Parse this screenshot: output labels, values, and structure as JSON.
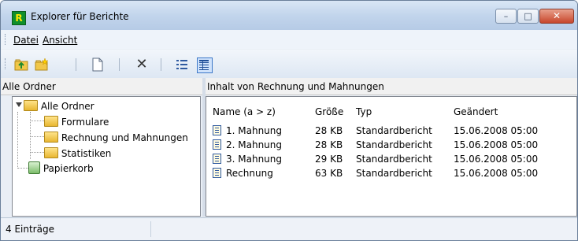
{
  "window": {
    "title": "Explorer für Berichte",
    "app_icon_letter": "R"
  },
  "title_buttons": {
    "minimize": "–",
    "maximize": "□",
    "close": "✕"
  },
  "menu": {
    "items": [
      {
        "label": "Datei"
      },
      {
        "label": "Ansicht"
      }
    ]
  },
  "toolbar": {
    "icons": [
      "folder-up-icon",
      "new-folder-icon",
      "new-report-icon",
      "delete-icon",
      "details-view-icon",
      "list-view-icon"
    ],
    "delete_glyph": "✕"
  },
  "left_pane": {
    "header": "Alle Ordner",
    "tree": {
      "root": "Alle Ordner",
      "children": [
        {
          "label": "Formulare"
        },
        {
          "label": "Rechnung und Mahnungen"
        },
        {
          "label": "Statistiken"
        }
      ],
      "recycle_bin": "Papierkorb"
    }
  },
  "right_pane": {
    "header": "Inhalt von Rechnung und Mahnungen",
    "columns": [
      "Name (a > z)",
      "Größe",
      "Typ",
      "Geändert"
    ],
    "rows": [
      {
        "name": "1. Mahnung",
        "size": "28 KB",
        "type": "Standardbericht",
        "modified": "15.06.2008 05:00"
      },
      {
        "name": "2. Mahnung",
        "size": "28 KB",
        "type": "Standardbericht",
        "modified": "15.06.2008 05:00"
      },
      {
        "name": "3. Mahnung",
        "size": "29 KB",
        "type": "Standardbericht",
        "modified": "15.06.2008 05:00"
      },
      {
        "name": "Rechnung",
        "size": "63 KB",
        "type": "Standardbericht",
        "modified": "15.06.2008 05:00"
      }
    ]
  },
  "status": {
    "text": "4 Einträge"
  },
  "colors": {
    "title_gradient": "#c2d5ec",
    "close_button": "#c7462b",
    "folder": "#e8b631",
    "selection": "#cfe2fb"
  }
}
